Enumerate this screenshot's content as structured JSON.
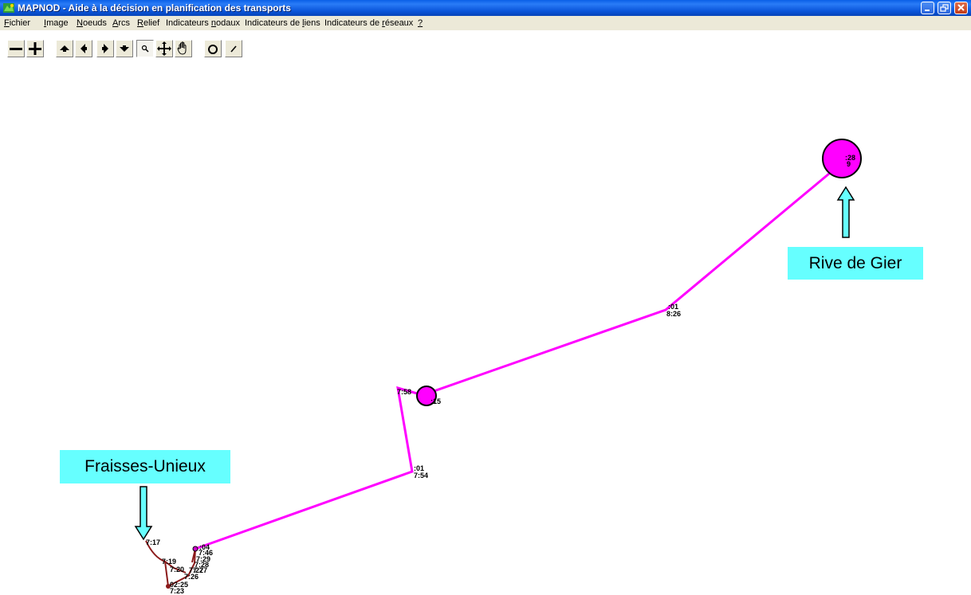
{
  "window": {
    "title": "MAPNOD - Aide à la décision en planification des transports",
    "icon": "mapnod-app-icon",
    "controls": [
      "minimize-icon",
      "restore-icon",
      "close-icon"
    ]
  },
  "menu": {
    "items": [
      {
        "pre": "",
        "ul": "F",
        "post": "ichier"
      },
      {
        "pre": "",
        "ul": "I",
        "post": "mage"
      },
      {
        "pre": "",
        "ul": "N",
        "post": "oeuds"
      },
      {
        "pre": "",
        "ul": "A",
        "post": "rcs"
      },
      {
        "pre": "",
        "ul": "R",
        "post": "elief"
      },
      {
        "pre": "Indicateurs ",
        "ul": "n",
        "post": "odaux"
      },
      {
        "pre": "Indicateurs de ",
        "ul": "l",
        "post": "iens"
      },
      {
        "pre": "Indicateurs de ",
        "ul": "r",
        "post": "éseaux"
      },
      {
        "pre": "",
        "ul": "?",
        "post": ""
      }
    ]
  },
  "toolbar": {
    "buttons": [
      "zoom-out-icon",
      "zoom-in-icon",
      "pan-up-icon",
      "pan-left-icon",
      "pan-right-icon",
      "pan-down-icon",
      "magnifier-icon",
      "move-icon",
      "hand-icon",
      "circle-icon",
      "line-icon"
    ],
    "pressed": "magnifier-icon"
  },
  "map": {
    "colors": {
      "route": "#ff00ff",
      "branch": "#8b1a1a",
      "node_outline": "#000000",
      "callout": "#66ffff"
    },
    "callouts": {
      "rive_de_gier": "Rive de Gier",
      "fraisses_unieux": "Fraisses-Unieux"
    },
    "labels": {
      "rive_top": ":28",
      "rive_bottom": "9",
      "n1_top": ":01",
      "n1_bottom": "8:26",
      "n2_left": "7:58",
      "n2_right": ":15",
      "n3_top": ":01",
      "n3_bottom": "7:54",
      "b_top": "7:17",
      "b_1": "7:19",
      "b_2": "7:20",
      "b_3": "7:27",
      "b_4": "7:26",
      "b_5": "02:25",
      "b_6": "7:23",
      "s_1": ":04",
      "s_2": "7:46",
      "s_3": "7:29",
      "s_4": "7:28",
      "s_5": "7:27"
    }
  }
}
